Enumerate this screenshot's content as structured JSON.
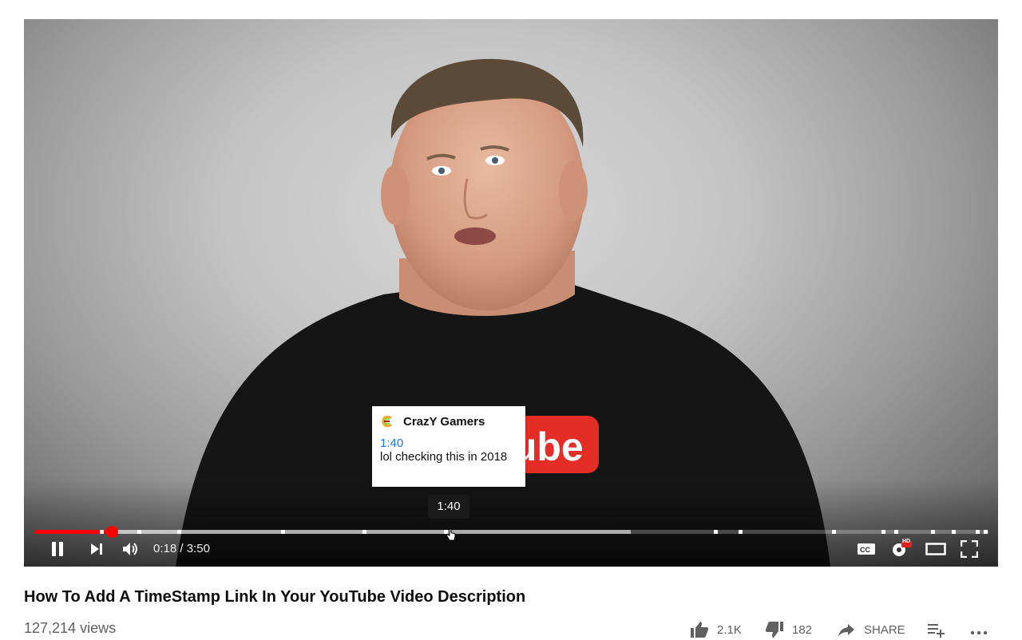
{
  "player": {
    "comment_card": {
      "author": "CrazY Gamers",
      "timestamp_link": "1:40",
      "text": "lol checking this in 2018"
    },
    "hover_time": "1:40",
    "time": {
      "current": "0:18",
      "separator": " / ",
      "duration": "3:50"
    },
    "progress": {
      "played_fraction": 0.08,
      "buffered_fraction": 0.625
    },
    "shirt_text": "Tube",
    "settings_badge": "HD",
    "controls": {
      "play_state_icon": "pause-icon",
      "next_icon": "next-icon",
      "volume_icon": "volume-icon",
      "cc_icon": "cc-icon",
      "settings_icon": "gear-icon",
      "theater_icon": "theater-icon",
      "fullscreen_icon": "fullscreen-icon"
    },
    "colors": {
      "progress_played": "#ff0000",
      "link": "#1a73e8"
    }
  },
  "video": {
    "title": "How To Add A TimeStamp Link In Your YouTube Video Description",
    "views": "127,214 views"
  },
  "actions": {
    "likes": "2.1K",
    "dislikes": "182",
    "share": "SHARE"
  }
}
